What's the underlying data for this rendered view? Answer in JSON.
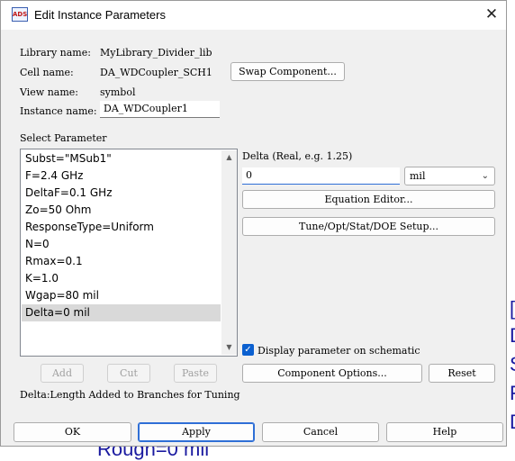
{
  "window": {
    "title": "Edit Instance Parameters",
    "icon_name": "ads-app-icon",
    "close_glyph": "✕"
  },
  "info": {
    "library_label": "Library name:",
    "library_value": "MyLibrary_Divider_lib",
    "cell_label": "Cell name:",
    "cell_value": "DA_WDCoupler_SCH1",
    "view_label": "View name:",
    "view_value": "symbol",
    "instance_label": "Instance name:",
    "instance_value": "DA_WDCoupler1",
    "swap_button": "Swap Component..."
  },
  "params": {
    "heading": "Select Parameter",
    "items": [
      "Subst=\"MSub1\"",
      "F=2.4 GHz",
      "DeltaF=0.1 GHz",
      "Zo=50 Ohm",
      "ResponseType=Uniform",
      "N=0",
      "Rmax=0.1",
      "K=1.0",
      "Wgap=80 mil",
      "Delta=0 mil"
    ],
    "selected_index": 9,
    "scroll_up": "▲",
    "scroll_down": "▼"
  },
  "editor": {
    "delta_label": "Delta (Real, e.g. 1.25)",
    "value": "0",
    "unit": "mil",
    "unit_chevron": "⌄",
    "equation_editor": "Equation Editor...",
    "tune_setup": "Tune/Opt/Stat/DOE Setup...",
    "display_checkbox_label": "Display parameter on schematic",
    "display_checked": true,
    "check_glyph": "✓",
    "component_options": "Component Options...",
    "reset": "Reset"
  },
  "list_actions": {
    "add": "Add",
    "cut": "Cut",
    "paste": "Paste"
  },
  "description": "Delta:Length Added to Branches for Tuning",
  "footer": {
    "ok": "OK",
    "apply": "Apply",
    "cancel": "Cancel",
    "help": "Help"
  },
  "background": {
    "bottom_text": "Rough=0 mil"
  }
}
